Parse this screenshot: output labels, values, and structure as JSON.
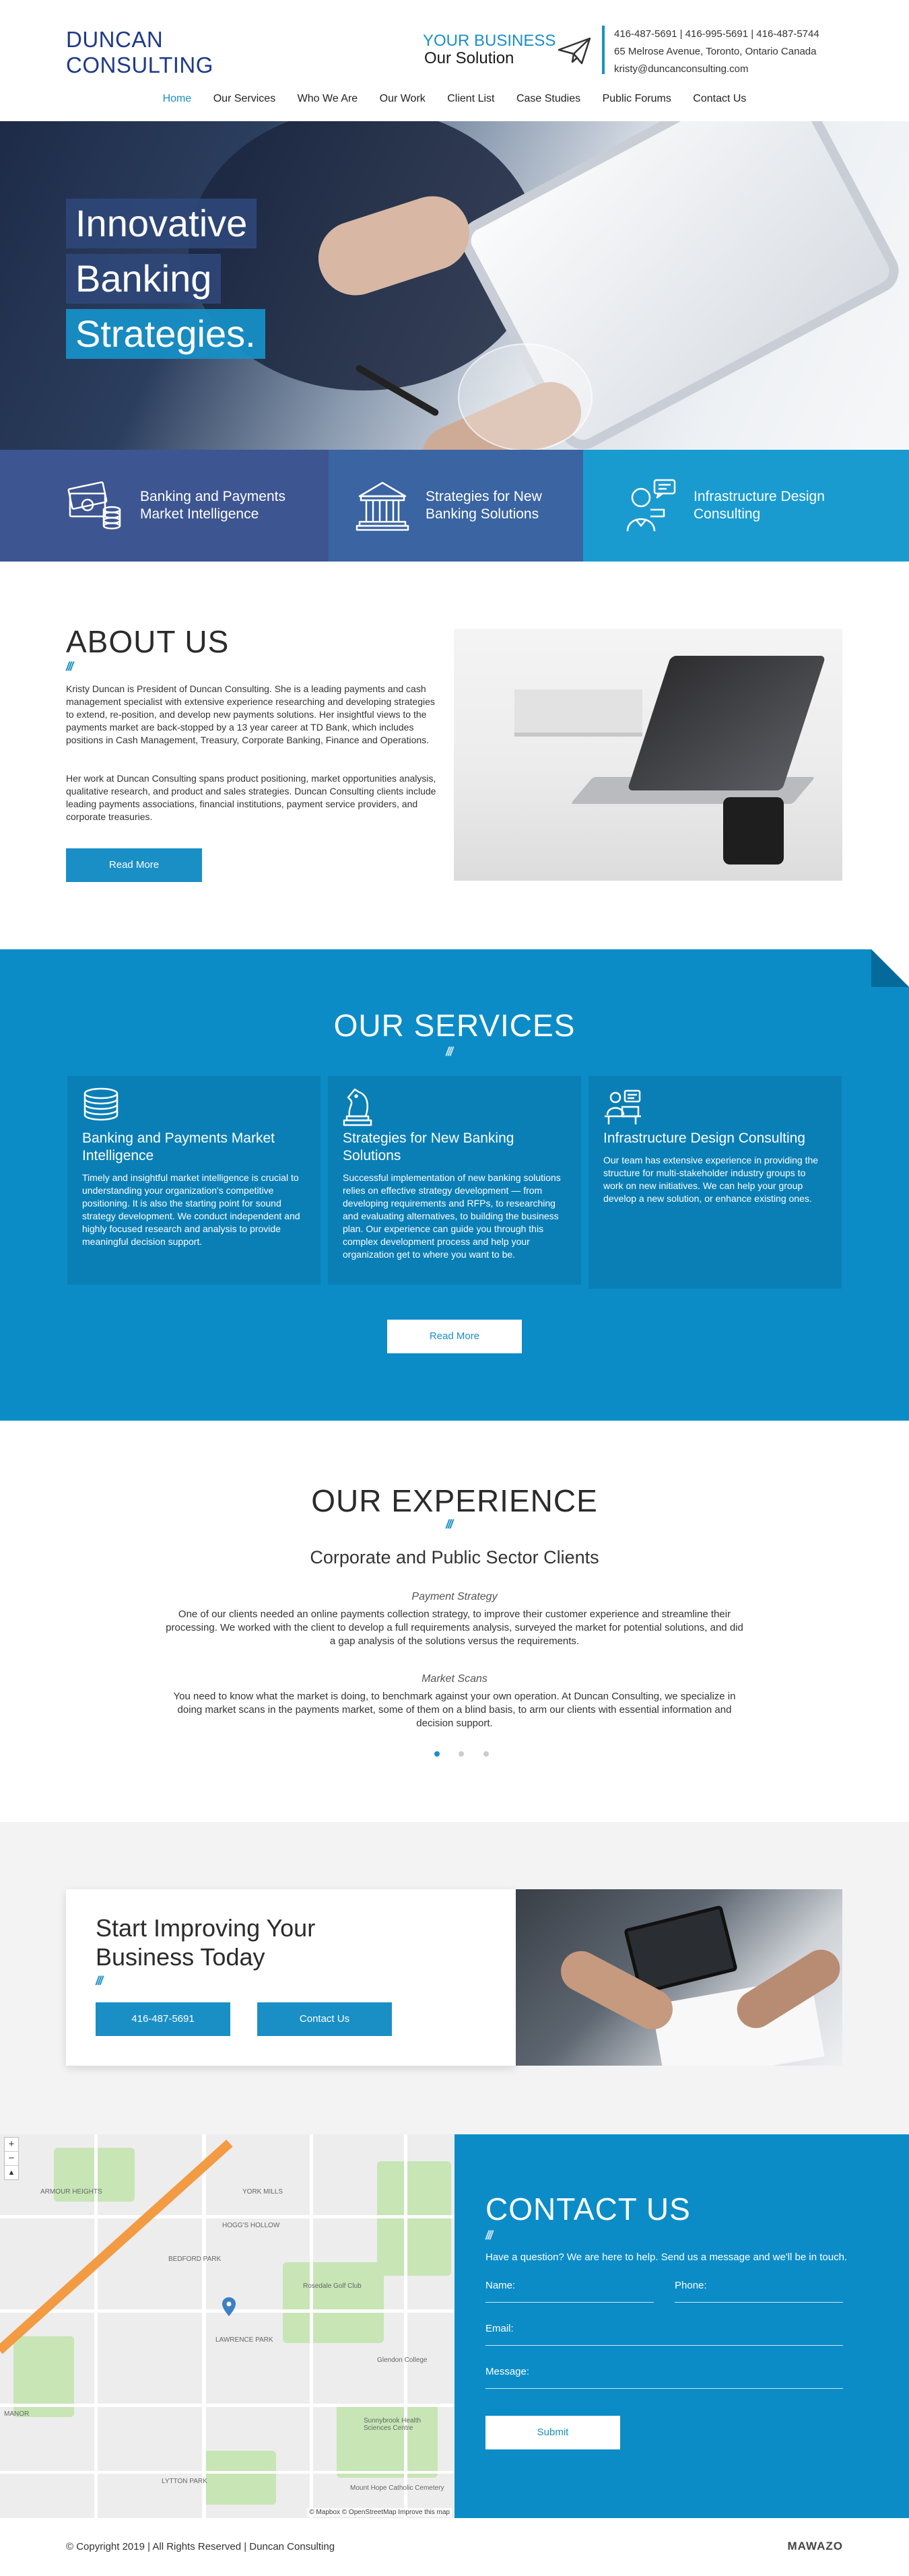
{
  "header": {
    "logo_line1": "DUNCAN",
    "logo_line2": "CONSULTING",
    "tagline_line1": "YOUR BUSINESS",
    "tagline_line2": "Our Solution",
    "phones": "416-487-5691 | 416-995-5691 | 416-487-5744",
    "address": "65 Melrose Avenue, Toronto, Ontario Canada",
    "email": "kristy@duncanconsulting.com",
    "icon": "paper-plane-icon"
  },
  "nav": {
    "items": [
      "Home",
      "Our Services",
      "Who We Are",
      "Our Work",
      "Client List",
      "Case Studies",
      "Public Forums",
      "Contact Us"
    ],
    "active": "Home"
  },
  "hero": {
    "line1": "Innovative",
    "line2": "Banking",
    "line3": "Strategies."
  },
  "features": [
    {
      "icon": "money-coins-icon",
      "line1": "Banking and Payments",
      "line2": "Market Intelligence"
    },
    {
      "icon": "bank-building-icon",
      "line1": "Strategies for New",
      "line2": "Banking Solutions"
    },
    {
      "icon": "consultant-chat-icon",
      "line1": "Infrastructure Design",
      "line2": "Consulting"
    }
  ],
  "about": {
    "title": "ABOUT US",
    "para1": "Kristy Duncan is President of Duncan Consulting. She is a leading payments and cash management specialist with extensive experience researching and developing strategies to extend, re-position, and develop new payments solutions. Her insightful views to the payments market are back-stopped by a 13 year career at TD Bank, which includes positions in Cash Management, Treasury, Corporate Banking, Finance and Operations.",
    "para2": "Her work at Duncan Consulting spans product positioning, market opportunities analysis, qualitative research, and product and sales strategies. Duncan Consulting clients include leading payments associations, financial institutions, payment service providers, and corporate treasuries.",
    "button": "Read More"
  },
  "services": {
    "title": "OUR SERVICES",
    "cards": [
      {
        "icon": "coin-stack-icon",
        "title": "Banking and Payments Market Intelligence",
        "text": "Timely and insightful market intelligence is crucial to understanding your organization's competitive positioning. It is also the starting point for sound strategy development. We conduct independent and highly focused research and analysis to provide meaningful decision support."
      },
      {
        "icon": "chess-knight-icon",
        "title": "Strategies for New Banking Solutions",
        "text": "Successful implementation of new banking solutions relies on effective strategy development — from developing requirements and RFPs, to researching and evaluating alternatives, to building the business plan. Our experience can guide you through this complex development process and help your organization get to where you want to be."
      },
      {
        "icon": "desk-worker-icon",
        "title": "Infrastructure Design Consulting",
        "text": "Our team has extensive experience in providing the structure for multi-stakeholder industry groups to work on new initiatives. We can help your group develop a new solution, or enhance existing ones."
      }
    ],
    "button": "Read More"
  },
  "experience": {
    "title": "OUR EXPERIENCE",
    "subtitle": "Corporate and Public Sector Clients",
    "items": [
      {
        "heading": "Payment Strategy",
        "text": "One of our clients needed an online payments collection strategy, to improve their customer experience and streamline their processing. We worked with the client to develop a full requirements analysis, surveyed the market for potential solutions, and did a gap analysis of the solutions versus the requirements."
      },
      {
        "heading": "Market Scans",
        "text": "You need to know what the market is doing, to benchmark against your own operation. At Duncan Consulting, we specialize in doing market scans in the payments market, some of them on a blind basis, to arm our clients with essential information and decision support."
      }
    ]
  },
  "cta": {
    "line1": "Start Improving Your",
    "line2": "Business Today",
    "phone_button": "416-487-5691",
    "contact_button": "Contact Us"
  },
  "map": {
    "zoom_in": "+",
    "zoom_out": "−",
    "attribution": "© Mapbox © OpenStreetMap Improve this map",
    "labels": [
      "ARMOUR HEIGHTS",
      "BEDFORD PARK",
      "LAWRENCE PARK",
      "YORK MILLS",
      "HOGG'S HOLLOW",
      "Sunnybrook Health Sciences Centre",
      "Glendon College",
      "Rosedale Golf Club",
      "Mount Hope Catholic Cemetery",
      "LYTTON PARK",
      "MANOR"
    ]
  },
  "contact": {
    "title": "CONTACT US",
    "help": "Have a question? We are here to help. Send us a message and we'll be in touch.",
    "name_label": "Name:",
    "phone_label": "Phone:",
    "email_label": "Email:",
    "message_label": "Message:",
    "submit": "Submit"
  },
  "footer": {
    "copyright": "© Copyright 2019 | All Rights Reserved | Duncan Consulting",
    "brand": "MAWAZO"
  },
  "colors": {
    "primary_blue": "#1a8fc6",
    "services_bg": "#0b8cc7",
    "navy": "#1f3a8a",
    "feature_1": "#3d5591",
    "feature_2": "#3a64a2",
    "feature_3": "#1a9bd0"
  }
}
